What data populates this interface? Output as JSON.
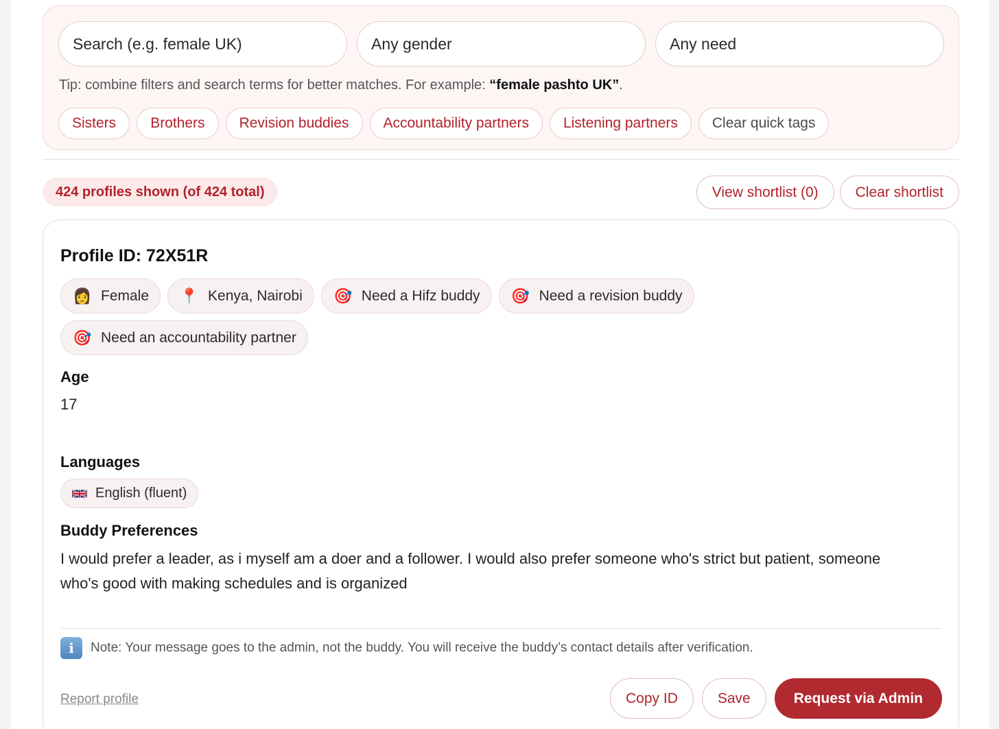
{
  "filters": {
    "search_placeholder": "Search (e.g. female UK)",
    "gender_value": "Any gender",
    "need_value": "Any need",
    "tip_prefix": "Tip: combine filters and search terms for better matches. For example: ",
    "tip_example": "“female pashto UK”",
    "tip_suffix": ".",
    "quick_tags": [
      "Sisters",
      "Brothers",
      "Revision buddies",
      "Accountability partners",
      "Listening partners"
    ],
    "clear_tags_label": "Clear quick tags"
  },
  "status": {
    "count_text": "424 profiles shown (of 424 total)",
    "view_shortlist_label": "View shortlist (0)",
    "clear_shortlist_label": "Clear shortlist"
  },
  "profile": {
    "id_text": "Profile ID: 72X51R",
    "chips": [
      {
        "icon": "woman-icon",
        "glyph": "👩",
        "label": "Female"
      },
      {
        "icon": "location-pin-icon",
        "glyph": "📍",
        "label": "Kenya, Nairobi"
      },
      {
        "icon": "target-icon",
        "glyph": "🎯",
        "label": "Need a Hifz buddy"
      },
      {
        "icon": "target-icon",
        "glyph": "🎯",
        "label": "Need a revision buddy"
      },
      {
        "icon": "target-icon",
        "glyph": "🎯",
        "label": "Need an accountability partner"
      }
    ],
    "age_label": "Age",
    "age_value": "17",
    "languages_label": "Languages",
    "language": {
      "flag_icon": "uk-flag-icon",
      "label": "English (fluent)"
    },
    "prefs_label": "Buddy Preferences",
    "prefs_text": "I would prefer a leader, as i myself am a doer and a follower. I would also prefer someone who's strict but patient, someone who's good with making schedules and is organized",
    "note_text": "Note: Your message goes to the admin, not the buddy. You will receive the buddy’s contact details after verification.",
    "report_label": "Report profile",
    "copy_label": "Copy ID",
    "save_label": "Save",
    "request_label": "Request via Admin"
  },
  "colors": {
    "accent": "#b2222a",
    "primary_button": "#b12a2f",
    "panel_bg": "#fdf6f5"
  }
}
